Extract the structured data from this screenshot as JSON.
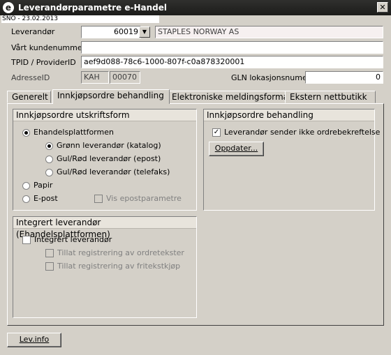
{
  "window": {
    "title": "Leverandørparametre e-Handel",
    "close_glyph": "✕",
    "sno_label": "SNO - 23.02.2013"
  },
  "form": {
    "supplier_label": "Leverandør",
    "supplier_number": "60019",
    "supplier_name": "STAPLES NORWAY AS",
    "customer_number_label": "Vårt kundenummer",
    "customer_number": "",
    "tpid_label": "TPID / ProviderID",
    "tpid_value": "aef9d088-78c6-1000-807f-c0a878320001",
    "address_label": "AdresseID",
    "address_code": "KAH",
    "address_number": "00070",
    "gln_label": "GLN lokasjonsnumer",
    "gln_value": "0"
  },
  "tabs": [
    {
      "label": "Generelt"
    },
    {
      "label": "Innkjøpsordre behandling"
    },
    {
      "label": "Elektroniske meldingsformat"
    },
    {
      "label": "Ekstern nettbutikk"
    }
  ],
  "print_group": {
    "title": "Innkjøpsordre utskriftsform",
    "ehandel": "Ehandelsplattformen",
    "green": "Grønn leverandør (katalog)",
    "yellow_email": "Gul/Rød leverandør (epost)",
    "yellow_fax": "Gul/Rød leverandør (telefaks)",
    "paper": "Papir",
    "email": "E-post",
    "show_email_params": "Vis epostparametre"
  },
  "processing_group": {
    "title": "Innkjøpsordre behandling",
    "no_confirmation": "Leverandør sender ikke ordrebekreftelse",
    "update_button": "Oppdater..."
  },
  "integrated_group": {
    "title": "Integrert leverandør (Ehandelsplattformen)",
    "integrated": "Integrert leverandør",
    "allow_order_texts": "Tillat registrering av ordretekster",
    "allow_free_text": "Tillat registrering av fritekstkjøp"
  },
  "footer": {
    "lev_info_button": "Lev.info"
  }
}
